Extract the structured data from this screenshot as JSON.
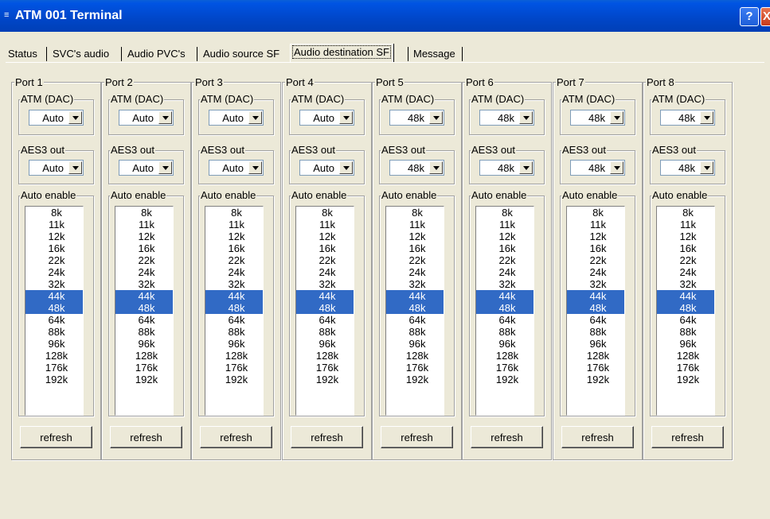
{
  "window": {
    "title": "ATM 001 Terminal",
    "help_label": "?",
    "close_label": "X"
  },
  "tabs": [
    {
      "label": "Status"
    },
    {
      "label": "SVC's audio"
    },
    {
      "label": "Audio PVC's"
    },
    {
      "label": "Audio source SF"
    },
    {
      "label": "Audio destination SF",
      "active": true
    },
    {
      "label": "Message"
    }
  ],
  "group_labels": {
    "dac": "ATM (DAC)",
    "aes": "AES3 out",
    "auto": "Auto enable"
  },
  "refresh_label": "refresh",
  "rates": [
    "8k",
    "11k",
    "12k",
    "16k",
    "22k",
    "24k",
    "32k",
    "44k",
    "48k",
    "64k",
    "88k",
    "96k",
    "128k",
    "176k",
    "192k"
  ],
  "selected_rates": [
    "44k",
    "48k"
  ],
  "ports": [
    {
      "label": "Port 1",
      "dac": "Auto",
      "aes": "Auto"
    },
    {
      "label": "Port 2",
      "dac": "Auto",
      "aes": "Auto"
    },
    {
      "label": "Port 3",
      "dac": "Auto",
      "aes": "Auto"
    },
    {
      "label": "Port 4",
      "dac": "Auto",
      "aes": "Auto"
    },
    {
      "label": "Port 5",
      "dac": "48k",
      "aes": "48k"
    },
    {
      "label": "Port 6",
      "dac": "48k",
      "aes": "48k"
    },
    {
      "label": "Port 7",
      "dac": "48k",
      "aes": "48k"
    },
    {
      "label": "Port 8",
      "dac": "48k",
      "aes": "48k"
    }
  ],
  "colors": {
    "titlebar": "#0054e3",
    "selection": "#316ac5",
    "dialog_bg": "#ece9d8"
  }
}
